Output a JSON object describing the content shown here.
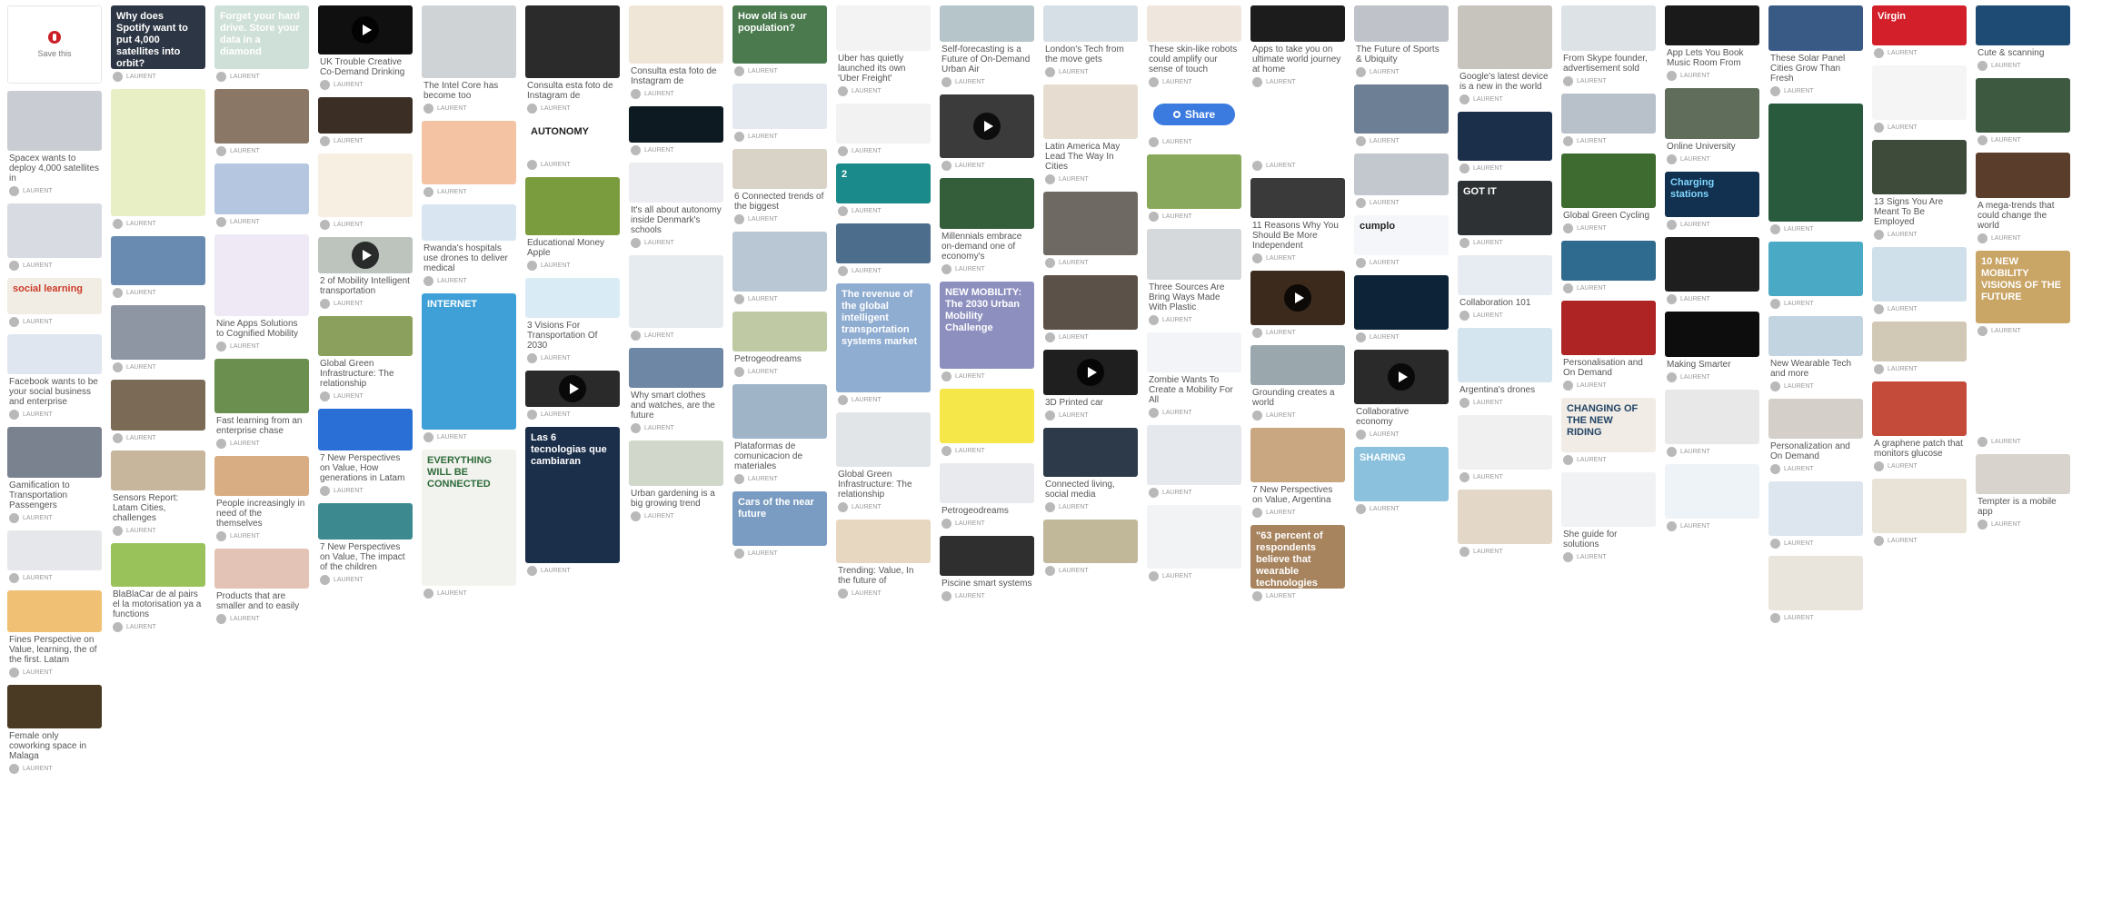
{
  "board": {
    "save_card_label": "Save this",
    "share_label": "Share",
    "columns": [
      [
        {
          "kind": "save"
        },
        {
          "h": 66,
          "bg": "#c9ccd3",
          "desc": "Spacex wants to deploy 4,000 satellites in",
          "by": "LAURENT"
        },
        {
          "h": 60,
          "bg": "#d8dbe1",
          "by": "LAURENT"
        },
        {
          "h": 40,
          "bg": "#f2ede4",
          "overlay": "social learning",
          "overlay_color": "#cc3b2b",
          "by": "LAURENT"
        },
        {
          "h": 44,
          "bg": "#e0e6ef",
          "desc": "Facebook wants to be your social business and enterprise",
          "by": "LAURENT"
        },
        {
          "h": 56,
          "bg": "#7a828f",
          "desc": "Gamification to Transportation Passengers",
          "by": "LAURENT"
        },
        {
          "h": 44,
          "bg": "#e5e7ea",
          "by": "LAURENT"
        },
        {
          "h": 46,
          "bg": "#f0c074",
          "desc": "Fines Perspective on Value, learning, the of the first. Latam",
          "by": "LAURENT"
        },
        {
          "h": 48,
          "bg": "#4a3a24",
          "desc": "Female only coworking space in Malaga",
          "by": "LAURENT"
        }
      ],
      [
        {
          "h": 70,
          "bg": "#2d3644",
          "overlay": "Why does Spotify want to put 4,000 satellites into orbit?",
          "overlay_color": "#ffffff",
          "by": "LAURENT"
        },
        {
          "h": 140,
          "bg": "#e9efc4",
          "desc": "",
          "by": "LAURENT"
        },
        {
          "h": 54,
          "bg": "#6a8bb1",
          "by": "LAURENT"
        },
        {
          "h": 60,
          "bg": "#8e96a3",
          "by": "LAURENT"
        },
        {
          "h": 56,
          "bg": "#7b6a55",
          "by": "LAURENT"
        },
        {
          "h": 44,
          "bg": "#c7b59c",
          "desc": "Sensors Report: Latam Cities, challenges",
          "by": "LAURENT"
        },
        {
          "h": 48,
          "bg": "#9ac25b",
          "desc": "BlaBlaCar de al pairs el la motorisation ya a functions",
          "by": "LAURENT"
        }
      ],
      [
        {
          "h": 70,
          "bg": "#cfe0d8",
          "overlay": "Forget your hard drive. Store your data in a diamond",
          "overlay_color": "#ffffff",
          "by": "LAURENT"
        },
        {
          "h": 60,
          "bg": "#8b7766",
          "by": "LAURENT"
        },
        {
          "h": 56,
          "bg": "#b4c6e0",
          "desc": "",
          "by": "LAURENT"
        },
        {
          "h": 90,
          "bg": "#efe9f5",
          "desc": "Nine Apps Solutions to Cognified Mobility",
          "by": "LAURENT"
        },
        {
          "h": 60,
          "bg": "#6b8f4f",
          "desc": "Fast learning from an enterprise chase",
          "by": "LAURENT"
        },
        {
          "h": 44,
          "bg": "#d8ad83",
          "desc": "People increasingly in need of the themselves",
          "by": "LAURENT"
        },
        {
          "h": 44,
          "bg": "#e3c3b6",
          "desc": "Products that are smaller and to easily",
          "by": "LAURENT"
        }
      ],
      [
        {
          "h": 54,
          "bg": "#101010",
          "video": true,
          "desc": "UK Trouble Creative Co-Demand Drinking",
          "by": "LAURENT"
        },
        {
          "h": 40,
          "bg": "#3b2e25",
          "by": "LAURENT"
        },
        {
          "h": 70,
          "bg": "#f6efe2",
          "by": "LAURENT"
        },
        {
          "h": 40,
          "bg": "#bcc4bd",
          "video": true,
          "desc": "2 of Mobility Intelligent transportation",
          "by": "LAURENT"
        },
        {
          "h": 44,
          "bg": "#8aa05c",
          "desc": "Global Green Infrastructure: The relationship",
          "by": "LAURENT"
        },
        {
          "h": 46,
          "bg": "#2a6fd6",
          "desc": "7 New Perspectives on Value, How generations in Latam",
          "by": "LAURENT"
        },
        {
          "h": 40,
          "bg": "#3c8a8f",
          "desc": "7 New Perspectives on Value, The impact of the children",
          "by": "LAURENT"
        }
      ],
      [
        {
          "h": 80,
          "bg": "#d0d3d6",
          "desc": "The Intel Core has become too",
          "by": "LAURENT"
        },
        {
          "h": 70,
          "bg": "#f4c3a3",
          "by": "LAURENT"
        },
        {
          "h": 40,
          "bg": "#d9e6f2",
          "desc": "Rwanda's hospitals use drones to deliver medical",
          "by": "LAURENT"
        },
        {
          "h": 150,
          "bg": "#3fa0d8",
          "overlay": "INTERNET",
          "overlay_color": "#ffffff",
          "by": "LAURENT"
        },
        {
          "h": 150,
          "bg": "#f2f2ee",
          "overlay": "EVERYTHING WILL BE CONNECTED",
          "overlay_color": "#2f6c3a",
          "by": "LAURENT"
        }
      ],
      [
        {
          "h": 80,
          "bg": "#2b2b2b",
          "desc": "Consulta esta foto de Instagram de",
          "by": "LAURENT"
        },
        {
          "h": 40,
          "bg": "#ffffff",
          "overlay": "AUTONOMY",
          "overlay_color": "#222222",
          "by": "LAURENT"
        },
        {
          "h": 64,
          "bg": "#7a9c3e",
          "desc": "Educational Money Apple",
          "by": "LAURENT"
        },
        {
          "h": 44,
          "bg": "#d9ebf5",
          "desc": "3 Visions For Transportation Of 2030",
          "by": "LAURENT"
        },
        {
          "h": 40,
          "bg": "#2a2a2a",
          "video": true,
          "by": "LAURENT"
        },
        {
          "h": 150,
          "bg": "#1b2e4a",
          "overlay": "Las 6 tecnologias que cambiaran",
          "overlay_color": "#ffffff",
          "by": "LAURENT"
        }
      ],
      [
        {
          "h": 64,
          "bg": "#efe6d7",
          "desc": "Consulta esta foto de Instagram de",
          "by": "LAURENT"
        },
        {
          "h": 40,
          "bg": "#0e1a22",
          "by": "LAURENT"
        },
        {
          "h": 44,
          "bg": "#ecedf0",
          "desc": "It's all about autonomy inside Denmark's schools",
          "by": "LAURENT"
        },
        {
          "h": 80,
          "bg": "#e6ebf0",
          "desc": "",
          "by": "LAURENT"
        },
        {
          "h": 44,
          "bg": "#6e87a5",
          "desc": "Why smart clothes and watches, are the future",
          "by": "LAURENT"
        },
        {
          "h": 50,
          "bg": "#d1d7cb",
          "desc": "Urban gardening is a big growing trend",
          "by": "LAURENT"
        }
      ],
      [
        {
          "h": 64,
          "bg": "#4a7a4e",
          "overlay": "How old is our population?",
          "overlay_color": "#ffffff",
          "by": "LAURENT"
        },
        {
          "h": 50,
          "bg": "#e3e9ef",
          "by": "LAURENT"
        },
        {
          "h": 44,
          "bg": "#d8d3c6",
          "desc": "6 Connected trends of the biggest",
          "by": "LAURENT"
        },
        {
          "h": 66,
          "bg": "#b9c6d3",
          "by": "LAURENT"
        },
        {
          "h": 44,
          "bg": "#bfc9a3",
          "desc": "Petrogeodreams",
          "by": "LAURENT"
        },
        {
          "h": 60,
          "bg": "#9fb4c7",
          "desc": "Plataformas de comunicacion de materiales",
          "by": "LAURENT"
        },
        {
          "h": 60,
          "bg": "#7a9cc2",
          "overlay": "Cars of the near future",
          "overlay_color": "#ffffff",
          "by": "LAURENT"
        }
      ],
      [
        {
          "h": 50,
          "bg": "#f3f3f3",
          "desc": "Uber has quietly launched its own 'Uber Freight'",
          "by": "LAURENT"
        },
        {
          "h": 44,
          "bg": "#f2f2f2",
          "by": "LAURENT"
        },
        {
          "h": 44,
          "bg": "#1a8a8a",
          "overlay": "2",
          "overlay_color": "#ffffff",
          "by": "LAURENT"
        },
        {
          "h": 44,
          "bg": "#4d6d8c",
          "by": "LAURENT"
        },
        {
          "h": 120,
          "bg": "#8facd1",
          "overlay": "The revenue of the global intelligent transportation systems market",
          "overlay_color": "#ffffff",
          "by": "LAURENT"
        },
        {
          "h": 60,
          "bg": "#e2e5e8",
          "desc": "Global Green Infrastructure: The relationship",
          "by": "LAURENT"
        },
        {
          "h": 48,
          "bg": "#e8d7c0",
          "desc": "Trending: Value, In the future of",
          "by": "LAURENT"
        }
      ],
      [
        {
          "h": 40,
          "bg": "#b6c5c9",
          "desc": "Self-forecasting is a Future of On-Demand Urban Air",
          "by": "LAURENT"
        },
        {
          "h": 70,
          "bg": "#3b3b3b",
          "video": true,
          "by": "LAURENT"
        },
        {
          "h": 56,
          "bg": "#345e3a",
          "desc": "Millennials embrace on-demand one of economy's",
          "by": "LAURENT"
        },
        {
          "h": 96,
          "bg": "#8d8fbf",
          "overlay": "NEW MOBILITY: The 2030 Urban Mobility Challenge",
          "overlay_color": "#ffffff",
          "by": "LAURENT"
        },
        {
          "h": 60,
          "bg": "#f5e64a",
          "by": "LAURENT"
        },
        {
          "h": 44,
          "bg": "#e8eaed",
          "desc": "Petrogeodreams",
          "by": "LAURENT"
        },
        {
          "h": 44,
          "bg": "#2f2f2f",
          "desc": "Piscine smart systems",
          "by": "LAURENT"
        }
      ],
      [
        {
          "h": 40,
          "bg": "#d7dfe6",
          "desc": "London's Tech from the move gets",
          "by": "LAURENT"
        },
        {
          "h": 60,
          "bg": "#e6ddd0",
          "desc": "Latin America May Lead The Way In Cities",
          "by": "LAURENT"
        },
        {
          "h": 70,
          "bg": "#6e6a63",
          "by": "LAURENT"
        },
        {
          "h": 60,
          "bg": "#5c5148",
          "by": "LAURENT"
        },
        {
          "h": 50,
          "bg": "#1f1f1f",
          "video": true,
          "desc": "3D Printed car",
          "by": "LAURENT"
        },
        {
          "h": 54,
          "bg": "#2c3a4a",
          "desc": "Connected living, social media",
          "by": "LAURENT"
        },
        {
          "h": 48,
          "bg": "#c1b89a",
          "by": "LAURENT"
        }
      ],
      [
        {
          "h": 40,
          "bg": "#efe6de",
          "desc": "These skin-like robots could amplify our sense of touch",
          "by": "LAURENT"
        },
        {
          "h": 44,
          "bg": "#ffffff",
          "share": true,
          "by": "LAURENT"
        },
        {
          "h": 60,
          "bg": "#88a85c",
          "by": "LAURENT"
        },
        {
          "h": 56,
          "bg": "#d6d9dc",
          "desc": "Three Sources Are Bring Ways Made With Plastic",
          "by": "LAURENT"
        },
        {
          "h": 44,
          "bg": "#f2f4f7",
          "desc": "Zombie Wants To Create a Mobility For All",
          "by": "LAURENT"
        },
        {
          "h": 66,
          "bg": "#e5e8ec",
          "by": "LAURENT"
        },
        {
          "h": 70,
          "bg": "#f1f3f5",
          "by": "LAURENT"
        }
      ],
      [
        {
          "h": 40,
          "bg": "#1c1c1c",
          "desc": "Apps to take you on ultimate world journey at home",
          "by": "LAURENT"
        },
        {
          "h": 70,
          "bg": "#ffffff",
          "by": "LAURENT"
        },
        {
          "h": 44,
          "bg": "#3a3a3a",
          "desc": "11 Reasons Why You Should Be More Independent",
          "by": "LAURENT"
        },
        {
          "h": 60,
          "bg": "#3c2a1c",
          "video": true,
          "by": "LAURENT"
        },
        {
          "h": 44,
          "bg": "#9aa7ad",
          "desc": "Grounding creates a world",
          "by": "LAURENT"
        },
        {
          "h": 60,
          "bg": "#c9a780",
          "desc": "7 New Perspectives on Value, Argentina",
          "by": "LAURENT"
        },
        {
          "h": 70,
          "bg": "#a7835e",
          "overlay": "\"63 percent of respondents believe that wearable technologies will\"",
          "overlay_color": "#ffffff",
          "by": "LAURENT"
        }
      ],
      [
        {
          "h": 40,
          "bg": "#bfc2c8",
          "desc": "The Future of Sports & Ubiquity",
          "by": "LAURENT"
        },
        {
          "h": 54,
          "bg": "#6d7f94",
          "by": "LAURENT"
        },
        {
          "h": 46,
          "bg": "#c2c8ce",
          "by": "LAURENT"
        },
        {
          "h": 44,
          "bg": "#f4f6f9",
          "overlay": "cumplo",
          "overlay_color": "#222222",
          "by": "LAURENT"
        },
        {
          "h": 60,
          "bg": "#0c2338",
          "by": "LAURENT"
        },
        {
          "h": 60,
          "bg": "#2a2a2a",
          "video": true,
          "desc": "Collaborative economy",
          "by": "LAURENT"
        },
        {
          "h": 60,
          "bg": "#8bc1dd",
          "overlay": "SHARING",
          "overlay_color": "#ffffff",
          "by": "LAURENT"
        }
      ],
      [
        {
          "h": 70,
          "bg": "#c7c3bd",
          "desc": "Google's latest device is a new in the world",
          "by": "LAURENT"
        },
        {
          "h": 54,
          "bg": "#1c2f4a",
          "by": "LAURENT"
        },
        {
          "h": 60,
          "bg": "#2e3133",
          "overlay": "GOT IT",
          "overlay_color": "#ffffff",
          "by": "LAURENT"
        },
        {
          "h": 44,
          "bg": "#e6ecf2",
          "desc": "Collaboration 101",
          "by": "LAURENT"
        },
        {
          "h": 60,
          "bg": "#d4e5ef",
          "desc": "Argentina's drones",
          "by": "LAURENT"
        },
        {
          "h": 60,
          "bg": "#f0f0f0",
          "by": "LAURENT"
        },
        {
          "h": 60,
          "bg": "#e3d7c7",
          "by": "LAURENT"
        }
      ],
      [
        {
          "h": 50,
          "bg": "#dde2e7",
          "desc": "From Skype founder, advertisement sold",
          "by": "LAURENT"
        },
        {
          "h": 44,
          "bg": "#b8c0c9",
          "by": "LAURENT"
        },
        {
          "h": 60,
          "bg": "#3e6b2f",
          "desc": "Global Green Cycling",
          "by": "LAURENT"
        },
        {
          "h": 44,
          "bg": "#2f6a8f",
          "by": "LAURENT"
        },
        {
          "h": 60,
          "bg": "#ae2324",
          "desc": "Personalisation and On Demand",
          "by": "LAURENT"
        },
        {
          "h": 60,
          "bg": "#f1ece5",
          "overlay": "CHANGING OF THE NEW RIDING",
          "overlay_color": "#224466",
          "by": "LAURENT"
        },
        {
          "h": 60,
          "bg": "#f0f2f4",
          "desc": "She guide for solutions",
          "by": "LAURENT"
        }
      ],
      [
        {
          "h": 44,
          "bg": "#1a1a1a",
          "desc": "App Lets You Book Music Room From",
          "by": "LAURENT"
        },
        {
          "h": 56,
          "bg": "#5f6d5a",
          "desc": "Online University",
          "by": "LAURENT"
        },
        {
          "h": 50,
          "bg": "#12304f",
          "overlay": "Charging stations",
          "overlay_color": "#7fd6ff",
          "by": "LAURENT"
        },
        {
          "h": 60,
          "bg": "#1e1e1e",
          "by": "LAURENT"
        },
        {
          "h": 50,
          "bg": "#0d0d0d",
          "desc": "Making Smarter",
          "by": "LAURENT"
        },
        {
          "h": 60,
          "bg": "#e8e8e8",
          "by": "LAURENT"
        },
        {
          "h": 60,
          "bg": "#eef3f7",
          "by": "LAURENT"
        }
      ],
      [
        {
          "h": 50,
          "bg": "#3a5a86",
          "desc": "These Solar Panel Cities Grow Than Fresh",
          "by": "LAURENT"
        },
        {
          "h": 130,
          "bg": "#2a5a3e",
          "by": "LAURENT"
        },
        {
          "h": 60,
          "bg": "#4aa9c4",
          "by": "LAURENT"
        },
        {
          "h": 44,
          "bg": "#c2d4e0",
          "desc": "New Wearable Tech and more",
          "by": "LAURENT"
        },
        {
          "h": 44,
          "bg": "#d4cfc8",
          "desc": "Personalization and On Demand",
          "by": "LAURENT"
        },
        {
          "h": 60,
          "bg": "#dde6ee",
          "by": "LAURENT"
        },
        {
          "h": 60,
          "bg": "#e9e5dd",
          "by": "LAURENT"
        }
      ],
      [
        {
          "h": 44,
          "bg": "#d31f29",
          "overlay": "Virgin",
          "overlay_color": "#ffffff",
          "by": "LAURENT"
        },
        {
          "h": 60,
          "bg": "#f5f5f5",
          "by": "LAURENT"
        },
        {
          "h": 60,
          "bg": "#3e4a3a",
          "desc": "13 Signs You Are Meant To Be Employed",
          "by": "LAURENT"
        },
        {
          "h": 60,
          "bg": "#cfe0ea",
          "by": "LAURENT"
        },
        {
          "h": 44,
          "bg": "#d1c8b6",
          "by": "LAURENT"
        },
        {
          "h": 60,
          "bg": "#c44a3a",
          "desc": "A graphene patch that monitors glucose",
          "by": "LAURENT"
        },
        {
          "h": 60,
          "bg": "#e8e3d6",
          "by": "LAURENT"
        }
      ],
      [
        {
          "h": 44,
          "bg": "#1d4b73",
          "desc": "Cute & scanning",
          "by": "LAURENT"
        },
        {
          "h": 60,
          "bg": "#3d5a40",
          "by": "LAURENT"
        },
        {
          "h": 50,
          "bg": "#5a3d2a",
          "desc": "A mega-trends that could change the world",
          "by": "LAURENT"
        },
        {
          "h": 80,
          "bg": "#c9a566",
          "overlay": "10 NEW MOBILITY VISIONS OF THE FUTURE",
          "overlay_color": "#ffffff",
          "by": "LAURENT"
        },
        {
          "h": 100,
          "bg": "#ffffff",
          "by": "LAURENT"
        },
        {
          "h": 44,
          "bg": "#d8d3cc",
          "desc": "Tempter is a mobile app",
          "by": "LAURENT"
        }
      ]
    ]
  }
}
